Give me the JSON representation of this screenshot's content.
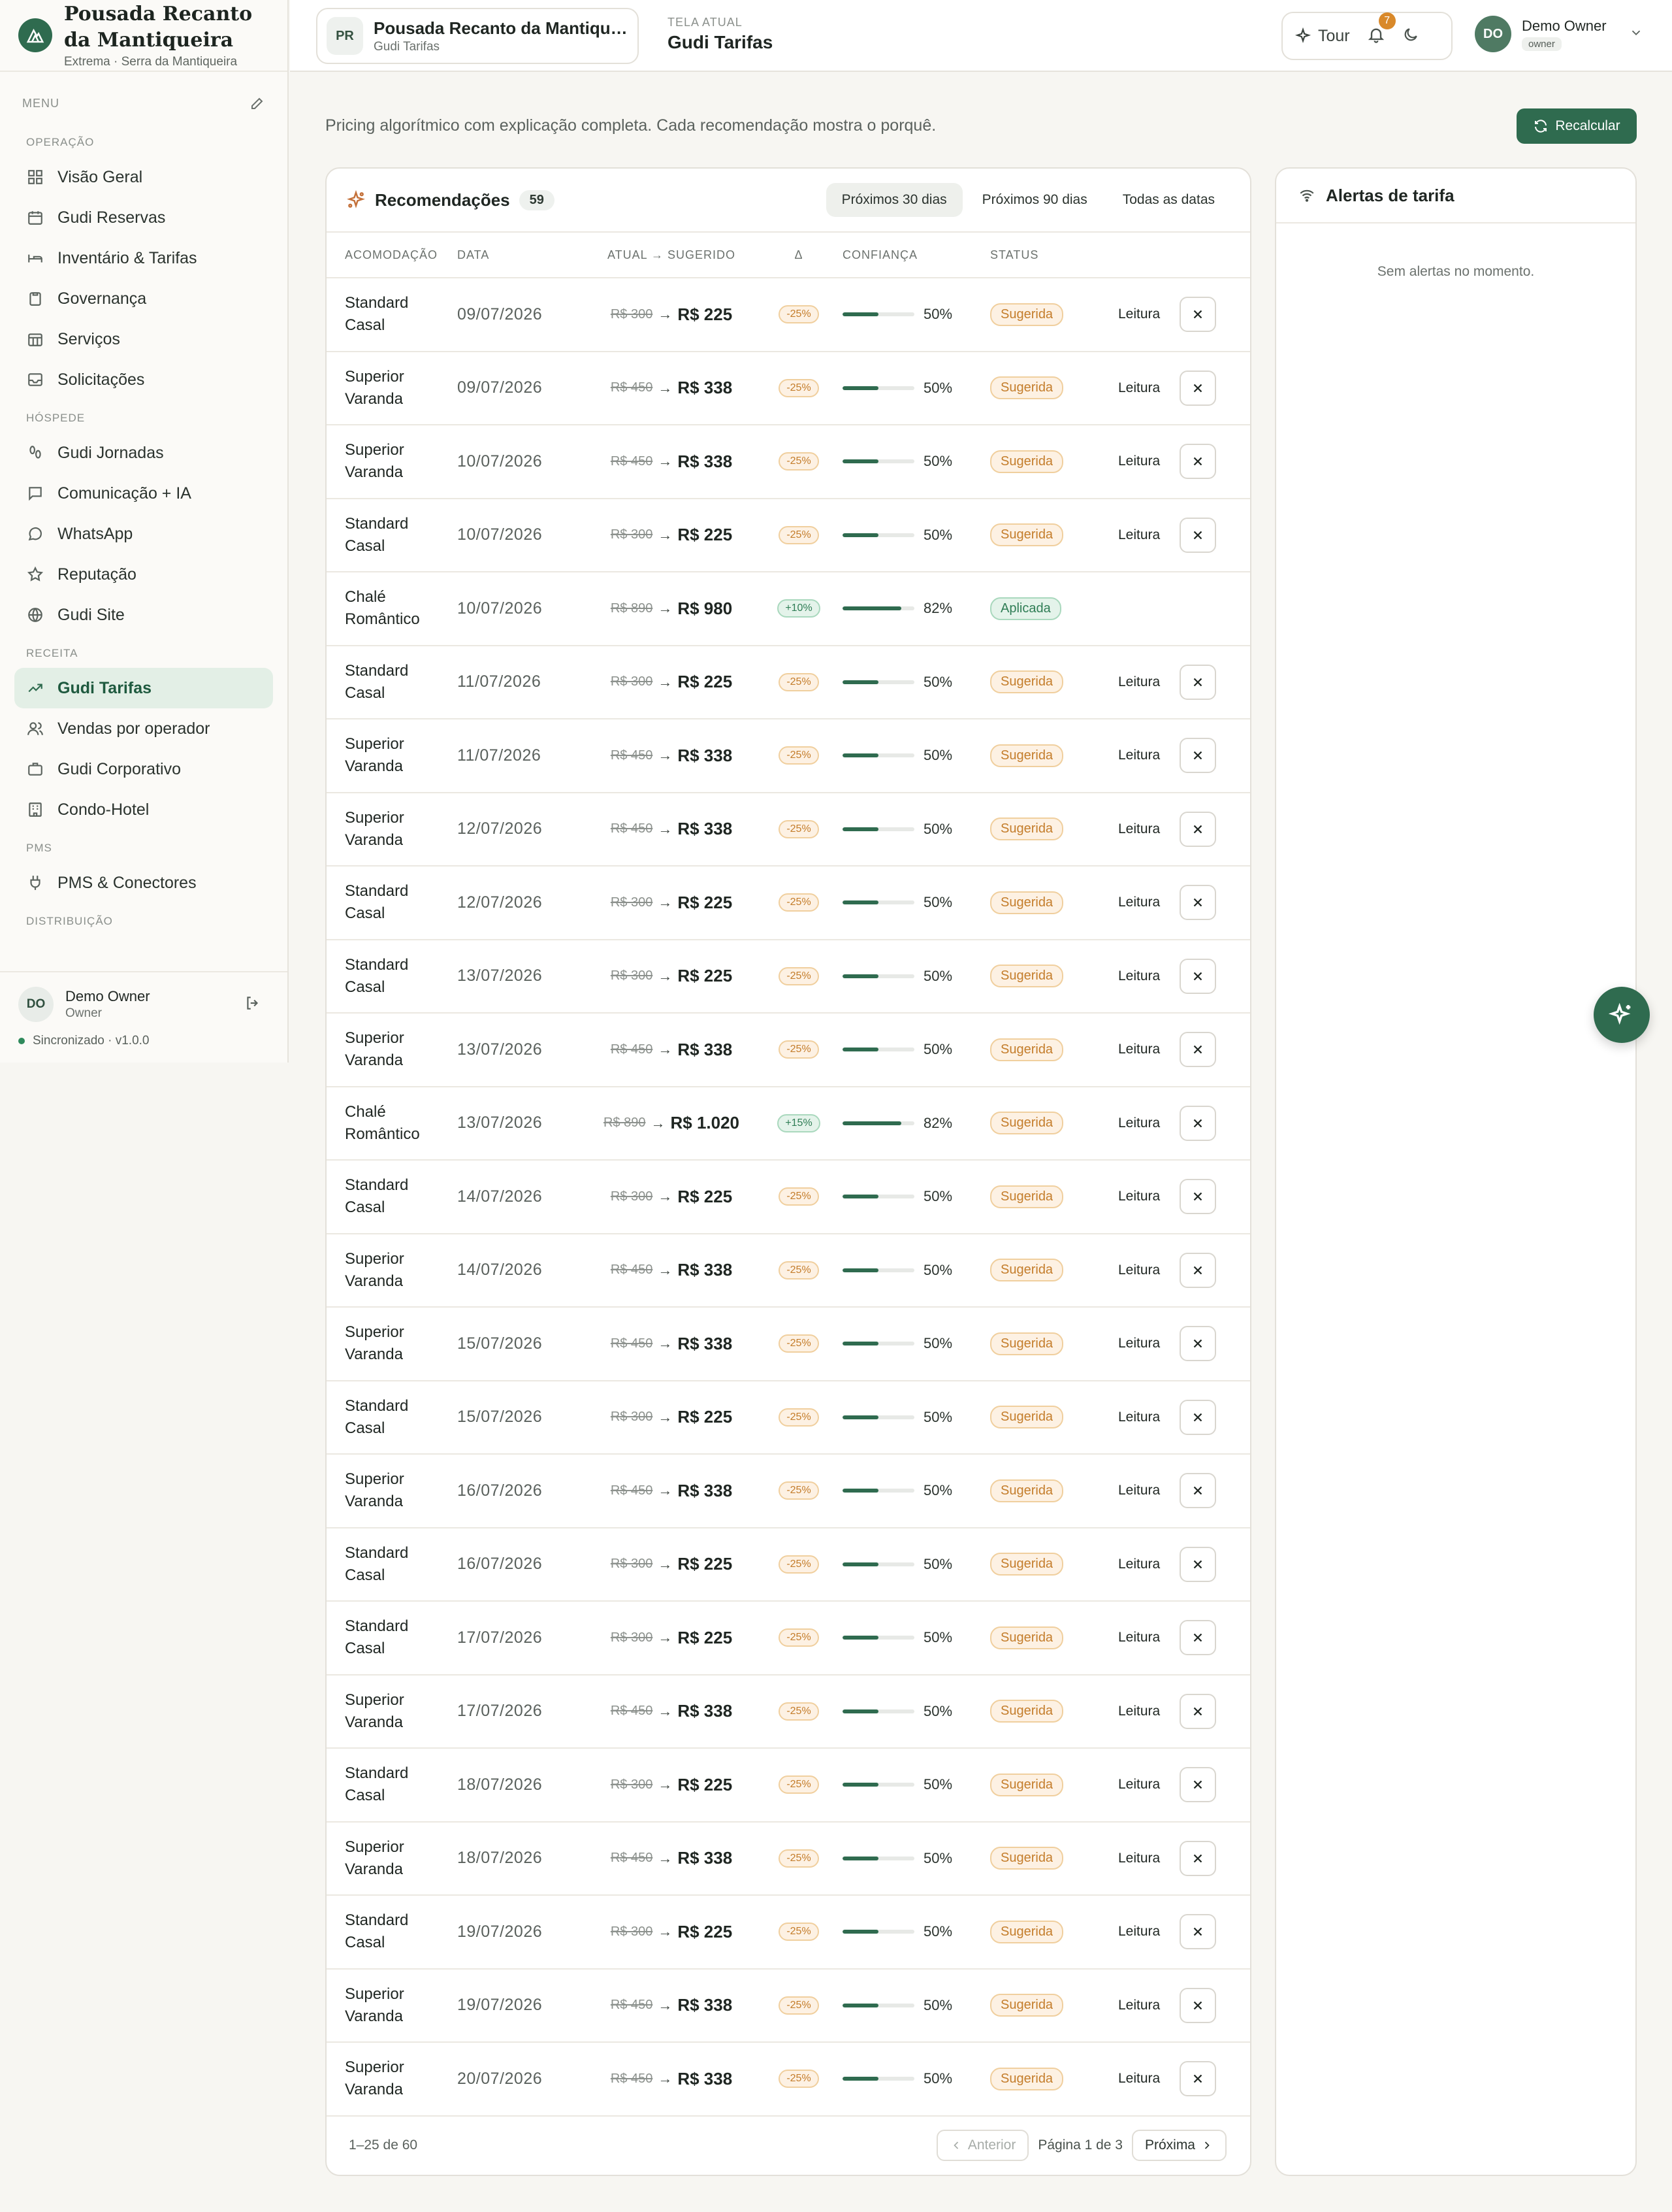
{
  "brand": {
    "name": "Pousada Recanto da Mantiqueira",
    "sub": "Extrema · Serra da Mantiqueira"
  },
  "sidebar": {
    "menu_label": "MENU",
    "sections": [
      {
        "label": "OPERAÇÃO",
        "items": [
          {
            "label": "Visão Geral",
            "icon": "dashboard-icon"
          },
          {
            "label": "Gudi Reservas",
            "icon": "calendar-icon"
          },
          {
            "label": "Inventário & Tarifas",
            "icon": "bed-icon"
          },
          {
            "label": "Governança",
            "icon": "clipboard-icon"
          },
          {
            "label": "Serviços",
            "icon": "calendar-grid-icon"
          },
          {
            "label": "Solicitações",
            "icon": "inbox-icon"
          }
        ]
      },
      {
        "label": "HÓSPEDE",
        "items": [
          {
            "label": "Gudi Jornadas",
            "icon": "footprints-icon"
          },
          {
            "label": "Comunicação + IA",
            "icon": "message-square-icon"
          },
          {
            "label": "WhatsApp",
            "icon": "message-circle-icon"
          },
          {
            "label": "Reputação",
            "icon": "star-icon"
          },
          {
            "label": "Gudi Site",
            "icon": "globe-icon"
          }
        ]
      },
      {
        "label": "RECEITA",
        "items": [
          {
            "label": "Gudi Tarifas",
            "icon": "trending-up-icon",
            "active": true
          },
          {
            "label": "Vendas por operador",
            "icon": "users-icon"
          },
          {
            "label": "Gudi Corporativo",
            "icon": "briefcase-icon"
          },
          {
            "label": "Condo-Hotel",
            "icon": "building-icon"
          }
        ]
      },
      {
        "label": "PMS",
        "items": [
          {
            "label": "PMS & Conectores",
            "icon": "plug-icon"
          }
        ]
      },
      {
        "label": "DISTRIBUIÇÃO",
        "items": []
      }
    ],
    "user": {
      "initials": "DO",
      "name": "Demo Owner",
      "role": "Owner"
    },
    "sync": "Sincronizado · v1.0.0"
  },
  "header": {
    "property": {
      "badge": "PR",
      "name": "Pousada Recanto da Mantiqueira",
      "sub": "Gudi Tarifas"
    },
    "screen_label": "TELA ATUAL",
    "screen_title": "Gudi Tarifas",
    "tour": "Tour",
    "notifications": "7",
    "user": {
      "initials": "DO",
      "name": "Demo Owner",
      "role": "owner"
    }
  },
  "main": {
    "subtitle": "Pricing algorítmico com explicação completa. Cada recomendação mostra o porquê.",
    "recalc_label": "Recalcular",
    "recommendations": {
      "title": "Recomendações",
      "count": "59",
      "tabs": [
        {
          "label": "Próximos 30 dias",
          "active": true
        },
        {
          "label": "Próximos 90 dias"
        },
        {
          "label": "Todas as datas"
        }
      ],
      "columns": [
        "ACOMODAÇÃO",
        "DATA",
        "ATUAL → SUGERIDO",
        "Δ",
        "CONFIANÇA",
        "STATUS"
      ],
      "rows": [
        {
          "room": "Standard Casal",
          "date": "09/07/2026",
          "old": "R$ 300",
          "new": "R$ 225",
          "delta": "-25%",
          "confidence": "50%",
          "conf_frac": 0.5,
          "status": "Sugerida"
        },
        {
          "room": "Superior Varanda",
          "date": "09/07/2026",
          "old": "R$ 450",
          "new": "R$ 338",
          "delta": "-25%",
          "confidence": "50%",
          "conf_frac": 0.5,
          "status": "Sugerida"
        },
        {
          "room": "Superior Varanda",
          "date": "10/07/2026",
          "old": "R$ 450",
          "new": "R$ 338",
          "delta": "-25%",
          "confidence": "50%",
          "conf_frac": 0.5,
          "status": "Sugerida"
        },
        {
          "room": "Standard Casal",
          "date": "10/07/2026",
          "old": "R$ 300",
          "new": "R$ 225",
          "delta": "-25%",
          "confidence": "50%",
          "conf_frac": 0.5,
          "status": "Sugerida"
        },
        {
          "room": "Chalé Romântico",
          "date": "10/07/2026",
          "old": "R$ 890",
          "new": "R$ 980",
          "delta": "+10%",
          "confidence": "82%",
          "conf_frac": 0.82,
          "status": "Aplicada"
        },
        {
          "room": "Standard Casal",
          "date": "11/07/2026",
          "old": "R$ 300",
          "new": "R$ 225",
          "delta": "-25%",
          "confidence": "50%",
          "conf_frac": 0.5,
          "status": "Sugerida"
        },
        {
          "room": "Superior Varanda",
          "date": "11/07/2026",
          "old": "R$ 450",
          "new": "R$ 338",
          "delta": "-25%",
          "confidence": "50%",
          "conf_frac": 0.5,
          "status": "Sugerida"
        },
        {
          "room": "Superior Varanda",
          "date": "12/07/2026",
          "old": "R$ 450",
          "new": "R$ 338",
          "delta": "-25%",
          "confidence": "50%",
          "conf_frac": 0.5,
          "status": "Sugerida"
        },
        {
          "room": "Standard Casal",
          "date": "12/07/2026",
          "old": "R$ 300",
          "new": "R$ 225",
          "delta": "-25%",
          "confidence": "50%",
          "conf_frac": 0.5,
          "status": "Sugerida"
        },
        {
          "room": "Standard Casal",
          "date": "13/07/2026",
          "old": "R$ 300",
          "new": "R$ 225",
          "delta": "-25%",
          "confidence": "50%",
          "conf_frac": 0.5,
          "status": "Sugerida"
        },
        {
          "room": "Superior Varanda",
          "date": "13/07/2026",
          "old": "R$ 450",
          "new": "R$ 338",
          "delta": "-25%",
          "confidence": "50%",
          "conf_frac": 0.5,
          "status": "Sugerida"
        },
        {
          "room": "Chalé Romântico",
          "date": "13/07/2026",
          "old": "R$ 890",
          "new": "R$ 1.020",
          "delta": "+15%",
          "confidence": "82%",
          "conf_frac": 0.82,
          "status": "Sugerida"
        },
        {
          "room": "Standard Casal",
          "date": "14/07/2026",
          "old": "R$ 300",
          "new": "R$ 225",
          "delta": "-25%",
          "confidence": "50%",
          "conf_frac": 0.5,
          "status": "Sugerida"
        },
        {
          "room": "Superior Varanda",
          "date": "14/07/2026",
          "old": "R$ 450",
          "new": "R$ 338",
          "delta": "-25%",
          "confidence": "50%",
          "conf_frac": 0.5,
          "status": "Sugerida"
        },
        {
          "room": "Superior Varanda",
          "date": "15/07/2026",
          "old": "R$ 450",
          "new": "R$ 338",
          "delta": "-25%",
          "confidence": "50%",
          "conf_frac": 0.5,
          "status": "Sugerida"
        },
        {
          "room": "Standard Casal",
          "date": "15/07/2026",
          "old": "R$ 300",
          "new": "R$ 225",
          "delta": "-25%",
          "confidence": "50%",
          "conf_frac": 0.5,
          "status": "Sugerida"
        },
        {
          "room": "Superior Varanda",
          "date": "16/07/2026",
          "old": "R$ 450",
          "new": "R$ 338",
          "delta": "-25%",
          "confidence": "50%",
          "conf_frac": 0.5,
          "status": "Sugerida"
        },
        {
          "room": "Standard Casal",
          "date": "16/07/2026",
          "old": "R$ 300",
          "new": "R$ 225",
          "delta": "-25%",
          "confidence": "50%",
          "conf_frac": 0.5,
          "status": "Sugerida"
        },
        {
          "room": "Standard Casal",
          "date": "17/07/2026",
          "old": "R$ 300",
          "new": "R$ 225",
          "delta": "-25%",
          "confidence": "50%",
          "conf_frac": 0.5,
          "status": "Sugerida"
        },
        {
          "room": "Superior Varanda",
          "date": "17/07/2026",
          "old": "R$ 450",
          "new": "R$ 338",
          "delta": "-25%",
          "confidence": "50%",
          "conf_frac": 0.5,
          "status": "Sugerida"
        },
        {
          "room": "Standard Casal",
          "date": "18/07/2026",
          "old": "R$ 300",
          "new": "R$ 225",
          "delta": "-25%",
          "confidence": "50%",
          "conf_frac": 0.5,
          "status": "Sugerida"
        },
        {
          "room": "Superior Varanda",
          "date": "18/07/2026",
          "old": "R$ 450",
          "new": "R$ 338",
          "delta": "-25%",
          "confidence": "50%",
          "conf_frac": 0.5,
          "status": "Sugerida"
        },
        {
          "room": "Standard Casal",
          "date": "19/07/2026",
          "old": "R$ 300",
          "new": "R$ 225",
          "delta": "-25%",
          "confidence": "50%",
          "conf_frac": 0.5,
          "status": "Sugerida"
        },
        {
          "room": "Superior Varanda",
          "date": "19/07/2026",
          "old": "R$ 450",
          "new": "R$ 338",
          "delta": "-25%",
          "confidence": "50%",
          "conf_frac": 0.5,
          "status": "Sugerida"
        },
        {
          "room": "Superior Varanda",
          "date": "20/07/2026",
          "old": "R$ 450",
          "new": "R$ 338",
          "delta": "-25%",
          "confidence": "50%",
          "conf_frac": 0.5,
          "status": "Sugerida"
        }
      ],
      "row_action": "Leitura",
      "pagination": {
        "range": "1–25 de 60",
        "prev": "Anterior",
        "page": "Página 1 de 3",
        "next": "Próxima"
      }
    },
    "alerts": {
      "title": "Alertas de tarifa",
      "empty": "Sem alertas no momento."
    }
  },
  "colors": {
    "accent": "#2f6b4f",
    "warning": "#c47d2b",
    "success": "#2f7d55"
  }
}
